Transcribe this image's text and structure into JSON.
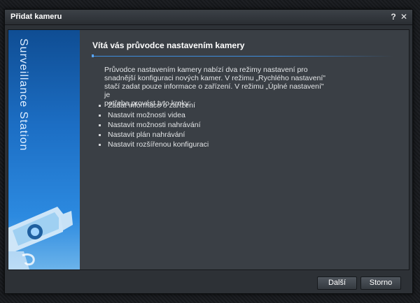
{
  "window": {
    "title": "Přidat kameru",
    "help_label": "?",
    "close_label": "✕"
  },
  "sidebar": {
    "brand": "Surveillance Station"
  },
  "content": {
    "heading": "Vítá vás průvodce nastavením kamery",
    "intro_lines": [
      "Průvodce nastavením kamery nabízí dva režimy nastavení pro",
      "snadnější konfiguraci nových kamer. V režimu „Rychlého nastavení\"",
      "stačí zadat pouze informace o zařízení. V režimu „Úplné nastavení\" je",
      "potřeba provést tyto kroky:"
    ],
    "steps": [
      "Zadat informace o zařízení",
      "Nastavit možnosti videa",
      "Nastavit možnosti nahrávání",
      "Nastavit plán nahrávání",
      "Nastavit rozšířenou konfiguraci"
    ]
  },
  "footer": {
    "next_label": "Další",
    "cancel_label": "Storno"
  },
  "colors": {
    "accent": "#3d8ddf",
    "sidebar_top": "#0f4d93",
    "sidebar_bottom": "#6bb3ea",
    "dialog_bg": "#3a3f45"
  }
}
